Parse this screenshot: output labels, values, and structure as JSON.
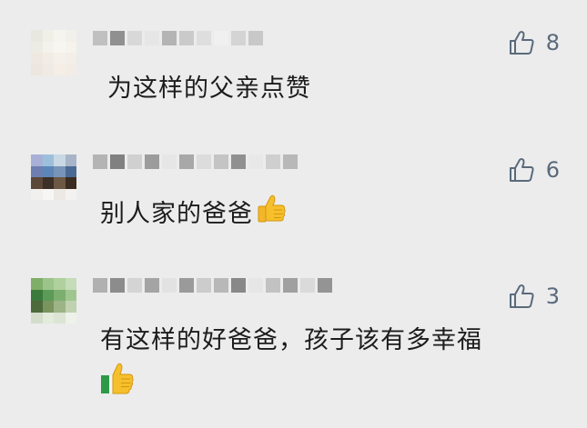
{
  "comments": [
    {
      "text": "为这样的父亲点赞",
      "likes": "8",
      "avatar_colors": [
        "#e8e8e0",
        "#f0f0e8",
        "#f6f4ee",
        "#f2f0ea",
        "#ecece4",
        "#f4f2ec",
        "#f8f6f0",
        "#f6f2ec",
        "#eee8e0",
        "#f2ece6",
        "#f6f0ea",
        "#f4eee8",
        "#ece6de",
        "#f0eae4",
        "#f4eee6",
        "#f2ece4"
      ],
      "name_blocks": [
        "#c0c0c0",
        "#909090",
        "#d8d8d8",
        "#e6e6e6",
        "#b4b4b4",
        "#cacaca",
        "#dedede",
        "#f0f0f0",
        "#d4d4d4",
        "#c8c8c8"
      ]
    },
    {
      "text": "别人家的爸爸",
      "likes": "6",
      "avatar_colors": [
        "#a8b0d8",
        "#9cc0dc",
        "#c8d8e4",
        "#a8b4c8",
        "#6c7fb0",
        "#5d86b8",
        "#7894b8",
        "#4a6a94",
        "#5c4838",
        "#3c3028",
        "#6c5844",
        "#3a2c20",
        "#f2f0ee",
        "#f8f6f4",
        "#ece8e4",
        "#f4f2f0"
      ],
      "name_blocks": [
        "#b4b4b4",
        "#808080",
        "#d0d0d0",
        "#9c9c9c",
        "#e6e6e6",
        "#a8a8a8",
        "#dcdcdc",
        "#c4c4c4",
        "#909090",
        "#e8e8e8",
        "#cfcfcf",
        "#b8b8b8"
      ]
    },
    {
      "text": "有这样的好爸爸，孩子该有多幸福",
      "likes": "3",
      "avatar_colors": [
        "#7fae68",
        "#9cc48a",
        "#b0d09e",
        "#c4dcb8",
        "#3c7a3c",
        "#5c9a58",
        "#7cae70",
        "#a0c690",
        "#4c6a3c",
        "#7a9460",
        "#9cb486",
        "#c0d2b0",
        "#d4dccc",
        "#e4eadc",
        "#dce4d4",
        "#eef2ea"
      ],
      "name_blocks": [
        "#b0b0b0",
        "#8c8c8c",
        "#d4d4d4",
        "#a4a4a4",
        "#e2e2e2",
        "#9a9a9a",
        "#cccccc",
        "#b8b8b8",
        "#888888",
        "#e6e6e6",
        "#c2c2c2",
        "#a0a0a0",
        "#dadada",
        "#949494"
      ]
    }
  ],
  "icons": {
    "like": "thumbs-up-outline-icon",
    "emoji": "thumbs-up-emoji-icon"
  },
  "colors": {
    "background": "#ececec",
    "like_icon": "#5a6a7c",
    "text": "#1c1c1c",
    "emoji_yellow": "#f6c02c",
    "emoji_sleeve": "#2e9a48"
  }
}
